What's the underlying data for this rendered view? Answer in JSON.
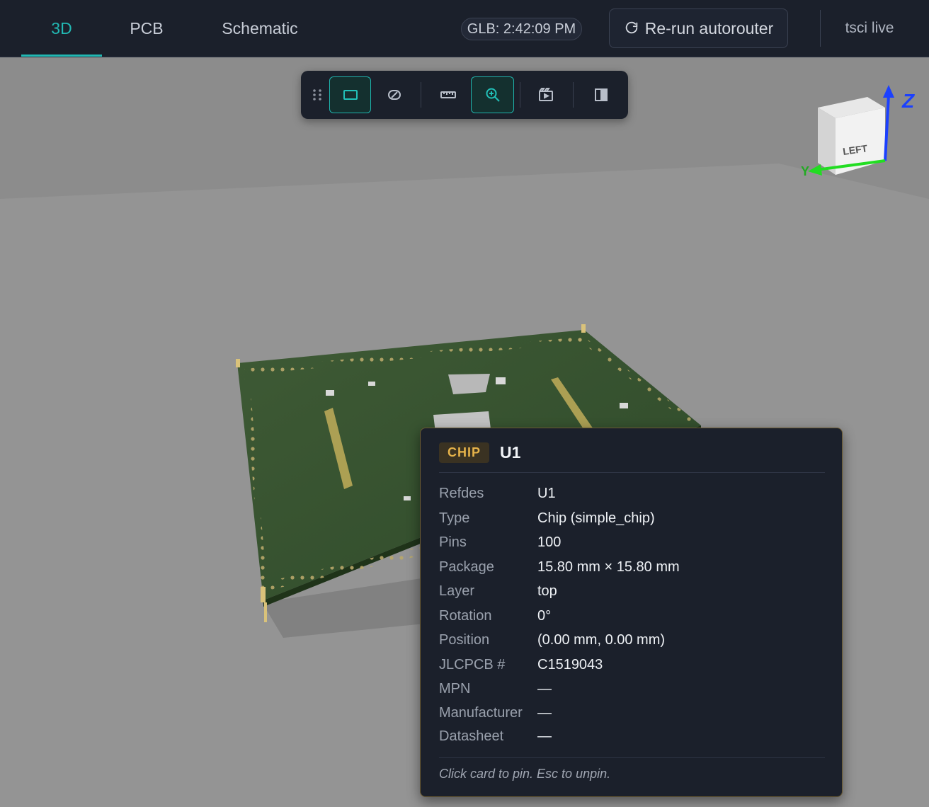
{
  "tabs": [
    {
      "label": "3D"
    },
    {
      "label": "PCB"
    },
    {
      "label": "Schematic"
    }
  ],
  "header": {
    "glb_time": "GLB: 2:42:09 PM",
    "rerun_label": "Re-run autorouter",
    "tsci_label": "tsci live"
  },
  "toolbar": {
    "buttons": [
      {
        "icon": "drag-handle-icon"
      },
      {
        "icon": "rectangle-icon",
        "active": true
      },
      {
        "icon": "hide-icon"
      },
      {
        "icon": "ruler-icon"
      },
      {
        "icon": "zoom-icon",
        "active": true
      },
      {
        "icon": "animation-icon"
      },
      {
        "icon": "panel-toggle-icon"
      }
    ]
  },
  "orientation_cube": {
    "face_label": "LEFT",
    "axis_z": "Z",
    "axis_y": "Y",
    "z_color": "#1b40ff",
    "y_color": "#22dd22"
  },
  "card": {
    "badge": "CHIP",
    "title": "U1",
    "rows": [
      {
        "label": "Refdes",
        "value": "U1"
      },
      {
        "label": "Type",
        "value": "Chip (simple_chip)"
      },
      {
        "label": "Pins",
        "value": "100"
      },
      {
        "label": "Package",
        "value": "15.80 mm × 15.80 mm"
      },
      {
        "label": "Layer",
        "value": "top"
      },
      {
        "label": "Rotation",
        "value": "0°"
      },
      {
        "label": "Position",
        "value": "(0.00 mm, 0.00 mm)"
      },
      {
        "label": "JLCPCB #",
        "value": "C1519043"
      },
      {
        "label": "MPN",
        "value": "—"
      },
      {
        "label": "Manufacturer",
        "value": "—"
      },
      {
        "label": "Datasheet",
        "value": "—"
      }
    ],
    "footer": "Click card to pin. Esc to unpin."
  },
  "colors": {
    "accent": "#22b8b3",
    "topbar_bg": "#1b202b",
    "badge_text": "#e6b34a",
    "pcb_green": "#36502f"
  }
}
